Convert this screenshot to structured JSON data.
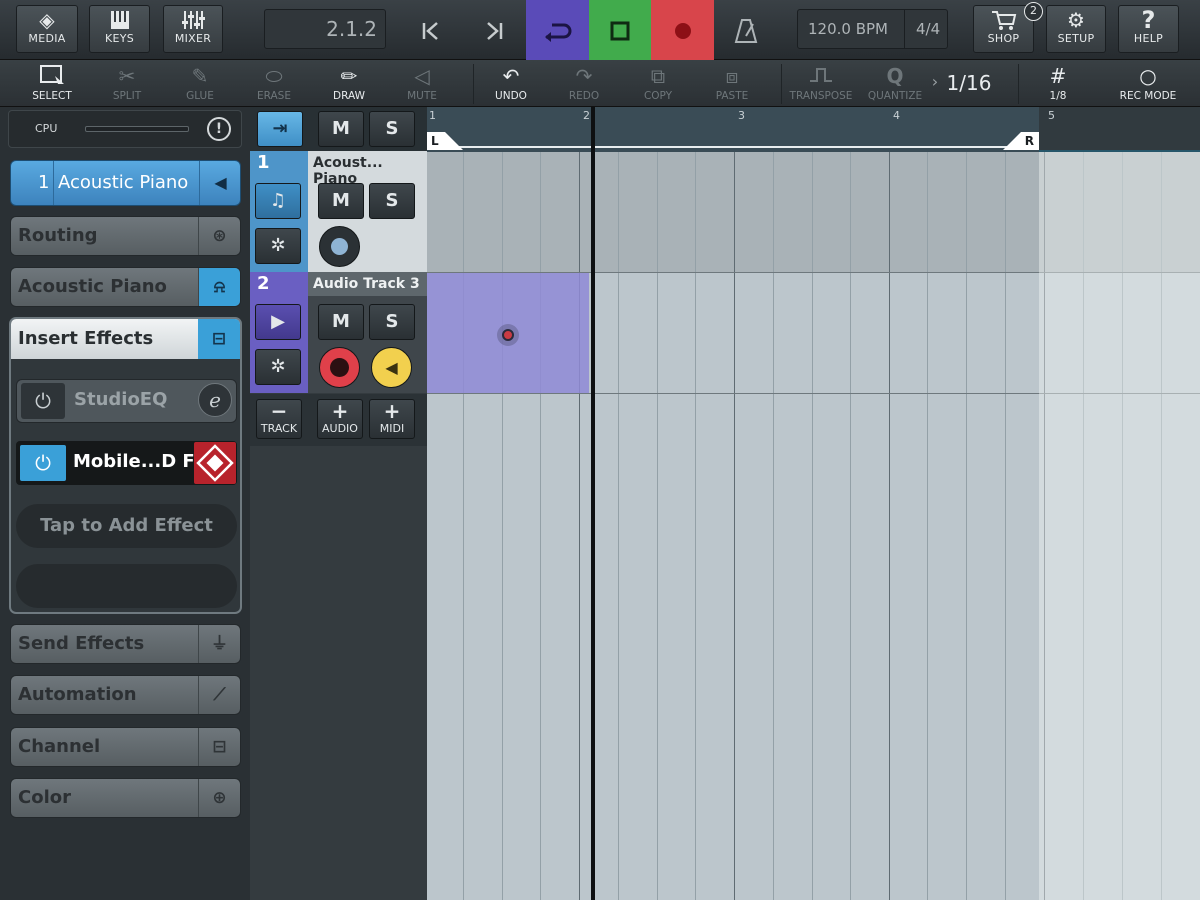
{
  "topbar": {
    "media_label": "MEDIA",
    "keys_label": "KEYS",
    "mixer_label": "MIXER",
    "position": "2.1.2",
    "tempo": "120.0 BPM",
    "signature": "4/4",
    "shop_label": "SHOP",
    "shop_badge": "2",
    "setup_label": "SETUP",
    "help_label": "HELP",
    "colors": {
      "cycle": "#5a4bb8",
      "stop": "#41ab4c",
      "record": "#d8454b"
    }
  },
  "toolbar": {
    "select": "SELECT",
    "split": "SPLIT",
    "glue": "GLUE",
    "erase": "ERASE",
    "draw": "DRAW",
    "mute": "MUTE",
    "undo": "UNDO",
    "redo": "REDO",
    "copy": "COPY",
    "paste": "PASTE",
    "transpose": "TRANSPOSE",
    "quantize": "QUANTIZE",
    "quantize_value": "1/16",
    "grid_value": "1/8",
    "rec_mode": "REC MODE"
  },
  "left_panel": {
    "cpu_label": "CPU",
    "track_number": "1",
    "track_name": "Acoustic Piano",
    "routing": "Routing",
    "instrument": "Acoustic Piano",
    "insert_effects": "Insert Effects",
    "effects": [
      {
        "name": "StudioEQ",
        "badge": "e"
      },
      {
        "name": "Mobile...D FX"
      }
    ],
    "add_effect": "Tap to Add Effect",
    "send_effects": "Send Effects",
    "automation": "Automation",
    "channel": "Channel",
    "color": "Color"
  },
  "tracks": [
    {
      "number": "1",
      "name": "Acoust... Piano",
      "color": "#4e95c9"
    },
    {
      "number": "2",
      "name": "Audio Track 3",
      "color": "#6a5fc2"
    }
  ],
  "track_controls": {
    "mute": "M",
    "solo": "S",
    "remove_track": "TRACK",
    "add_audio": "AUDIO",
    "add_midi": "MIDI"
  },
  "ruler": {
    "bars": [
      "1",
      "2",
      "3",
      "4",
      "5"
    ],
    "left_locator": "L",
    "right_locator": "R"
  }
}
